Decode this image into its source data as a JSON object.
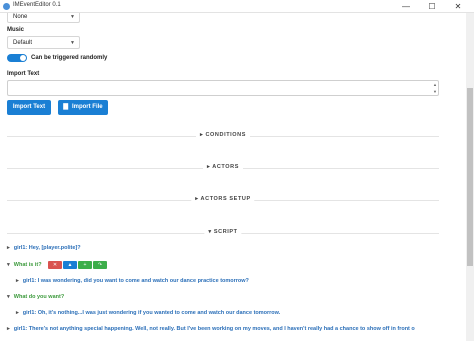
{
  "window": {
    "title": "IMEventEditor 0.1",
    "controls": {
      "minimize": "—",
      "maximize": "☐",
      "close": "✕"
    }
  },
  "form": {
    "top_select_value": "None",
    "music_label": "Music",
    "music_value": "Default",
    "random_toggle_label": "Can be triggered randomly",
    "import_label": "Import Text",
    "import_text_button": "Import Text",
    "import_file_button": "Import File"
  },
  "sections": {
    "conditions": "CONDITIONS",
    "actors": "ACTORS",
    "actors_setup": "ACTORS SETUP",
    "script": "SCRIPT"
  },
  "script_lines": [
    {
      "text": "girl1: Hey, [player.polite]?"
    },
    {
      "text": "What is it?"
    },
    {
      "text": "girl1: I was wondering, did you want to come and watch our dance practice tomorrow?"
    },
    {
      "text": "What do you want?"
    },
    {
      "text": "girl1: Oh, it's nothing...I was just wondering if you wanted to come and watch our dance tomorrow."
    },
    {
      "text": "girl1: There's not anything special happening. Well, not really. But I've been working on my moves, and I haven't really had a chance to show off in front o"
    }
  ],
  "tool_buttons": {
    "delete": "✕",
    "up": "▲",
    "add": "+",
    "go": "↷"
  },
  "colors": {
    "accent": "#1a7fd4",
    "dialogue": "#2b6fb8",
    "choice": "#3c9a3c",
    "delete": "#d9534f"
  }
}
